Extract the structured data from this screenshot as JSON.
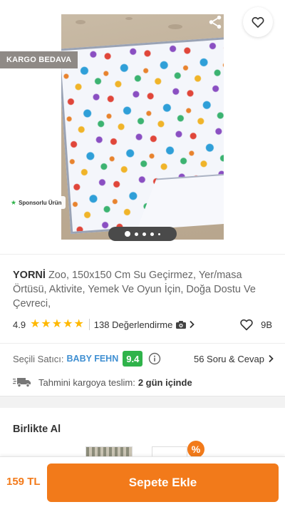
{
  "gallery": {
    "cargo_badge": "KARGO BEDAVA",
    "sponsored_label": "Sponsorlu Ürün",
    "image_count": 5,
    "active_image_index": 1,
    "icons": {
      "back": "back-arrow-icon",
      "share": "share-icon",
      "favorite": "heart-outline-icon",
      "sponsor": "star-icon"
    }
  },
  "product": {
    "brand": "YORNİ",
    "title": "Zoo, 150x150 Cm Su Geçirmez, Yer/masa Örtüsü, Aktivite, Yemek Ve Oyun İçin, Doğa Dostu Ve Çevreci,",
    "rating": "4.9",
    "rating_stars": 5,
    "reviews": "138 Değerlendirme",
    "likes": "9B"
  },
  "seller": {
    "label": "Seçili Satıcı:",
    "name": "BABY FEHN",
    "score": "9.4",
    "qa_link": "56 Soru & Cevap",
    "delivery_label": "Tahmini kargoya teslim:",
    "delivery_time": "2 gün içinde"
  },
  "bought_together": {
    "title": "Birlikte Al",
    "discount_symbol": "%"
  },
  "bottom_bar": {
    "price": "159 TL",
    "add_to_cart": "Sepete Ekle"
  },
  "colors": {
    "accent": "#f27a1a",
    "star": "#ffb800",
    "seller_link": "#3f8fd2",
    "score_badge": "#2fb34a"
  }
}
